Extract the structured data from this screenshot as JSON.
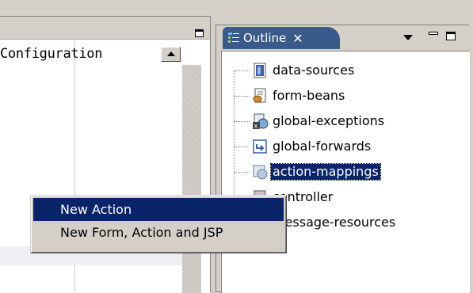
{
  "editor": {
    "text": "Configuration"
  },
  "outline": {
    "tab_label": "Outline",
    "tab_icon": "outline-view-icon",
    "items": [
      {
        "label": "data-sources",
        "icon": "data-sources-icon"
      },
      {
        "label": "form-beans",
        "icon": "form-beans-icon"
      },
      {
        "label": "global-exceptions",
        "icon": "global-exceptions-icon"
      },
      {
        "label": "global-forwards",
        "icon": "global-forwards-icon"
      },
      {
        "label": "action-mappings",
        "icon": "action-mappings-icon",
        "selected": true
      },
      {
        "label": "controller",
        "icon": "controller-icon"
      },
      {
        "label": "message-resources",
        "icon": "message-resources-icon"
      }
    ]
  },
  "context_menu": {
    "items": [
      {
        "label": "New Action",
        "highlighted": true
      },
      {
        "label": "New Form, Action and JSP"
      }
    ]
  },
  "colors": {
    "selection": "#0a246a",
    "tab_active": "#3a5a8c",
    "chrome": "#d4d0c8"
  }
}
